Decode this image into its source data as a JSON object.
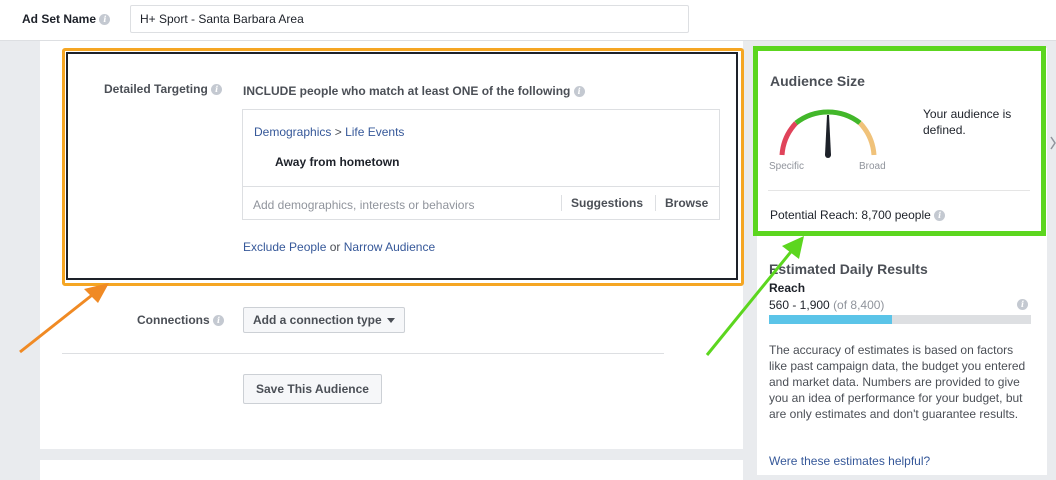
{
  "adset": {
    "label": "Ad Set Name",
    "value": "H+ Sport - Santa Barbara Area"
  },
  "targeting": {
    "label": "Detailed Targeting",
    "include_text": "INCLUDE people who match at least ONE of the following",
    "breadcrumb": {
      "category": "Demographics",
      "separator": " > ",
      "subcategory": "Life Events"
    },
    "item": "Away from hometown",
    "add_placeholder": "Add demographics, interests or behaviors",
    "suggestions_label": "Suggestions",
    "browse_label": "Browse",
    "exclude_link": "Exclude People",
    "or_text": " or ",
    "narrow_link": "Narrow Audience"
  },
  "connections": {
    "label": "Connections",
    "button_label": "Add a connection type"
  },
  "save_button_label": "Save This Audience",
  "audience_size": {
    "title": "Audience Size",
    "status": "Your audience is defined.",
    "gauge_left_label": "Specific",
    "gauge_right_label": "Broad",
    "potential_reach": "Potential Reach: 8,700 people"
  },
  "estimated": {
    "title": "Estimated Daily Results",
    "reach_label": "Reach",
    "reach_range": "560 - 1,900",
    "reach_total": "(of 8,400)",
    "reach_fill_fraction": 0.47,
    "description": "The accuracy of estimates is based on factors like past campaign data, the budget you entered and market data. Numbers are provided to give you an idea of performance for your budget, but are only estimates and don't guarantee results.",
    "helpful_link": "Were these estimates helpful?"
  },
  "colors": {
    "highlight_orange": "#f5a623",
    "highlight_green": "#5cd61f",
    "link_blue": "#365899",
    "reach_bar": "#5bc4e8"
  },
  "icons": [
    "info-icon",
    "gauge-icon",
    "dropdown-caret-icon",
    "annotation-arrow"
  ]
}
